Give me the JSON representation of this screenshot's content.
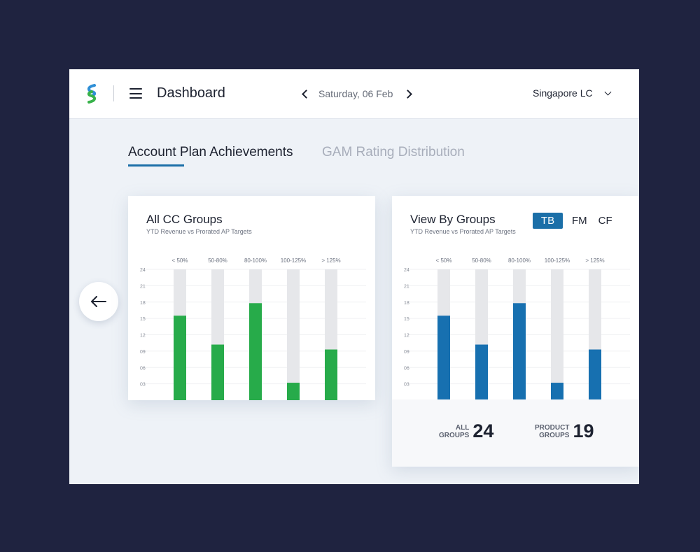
{
  "header": {
    "title": "Dashboard",
    "date": "Saturday, 06 Feb",
    "location": "Singapore LC"
  },
  "tabs": [
    {
      "label": "Account Plan Achievements",
      "active": true
    },
    {
      "label": "GAM Rating Distribution",
      "active": false
    }
  ],
  "icons": {
    "logo": "standard-chartered-logo",
    "menu": "hamburger-icon",
    "prev": "chevron-left-icon",
    "next": "chevron-right-icon",
    "dropdown": "chevron-down-icon",
    "back": "arrow-left-icon"
  },
  "colors": {
    "accent": "#1b6fa8",
    "green": "#27ab4a",
    "blue": "#1770b0",
    "track": "#e6e7ea",
    "logo_blue": "#2f8fd6",
    "logo_green": "#38b24a"
  },
  "cards": [
    {
      "title": "All CC Groups",
      "subtitle": "YTD Revenue vs Prorated AP Targets",
      "chart_data": {
        "type": "bar",
        "categories": [
          "< 50%",
          "50-80%",
          "80-100%",
          "100-125%",
          "> 125%"
        ],
        "values": [
          15.5,
          10.2,
          17.8,
          3.2,
          9.3
        ],
        "max": 24,
        "yticks": [
          "24",
          "21",
          "18",
          "15",
          "12",
          "09",
          "06",
          "03"
        ],
        "ytick_values": [
          24,
          21,
          18,
          15,
          12,
          9,
          6,
          3
        ],
        "bar_color": "#27ab4a"
      }
    },
    {
      "title": "View By Groups",
      "subtitle": "YTD Revenue vs Prorated AP Targets",
      "segments": [
        {
          "label": "TB",
          "active": true
        },
        {
          "label": "FM",
          "active": false
        },
        {
          "label": "CF",
          "active": false
        }
      ],
      "chart_data": {
        "type": "bar",
        "categories": [
          "< 50%",
          "50-80%",
          "80-100%",
          "100-125%",
          "> 125%"
        ],
        "values": [
          15.5,
          10.2,
          17.8,
          3.2,
          9.3
        ],
        "max": 24,
        "yticks": [
          "24",
          "21",
          "18",
          "15",
          "12",
          "09",
          "06",
          "03"
        ],
        "ytick_values": [
          24,
          21,
          18,
          15,
          12,
          9,
          6,
          3
        ],
        "bar_color": "#1770b0"
      },
      "summary": [
        {
          "label_line1": "ALL",
          "label_line2": "GROUPS",
          "value": "24"
        },
        {
          "label_line1": "PRODUCT",
          "label_line2": "GROUPS",
          "value": "19"
        }
      ]
    }
  ]
}
